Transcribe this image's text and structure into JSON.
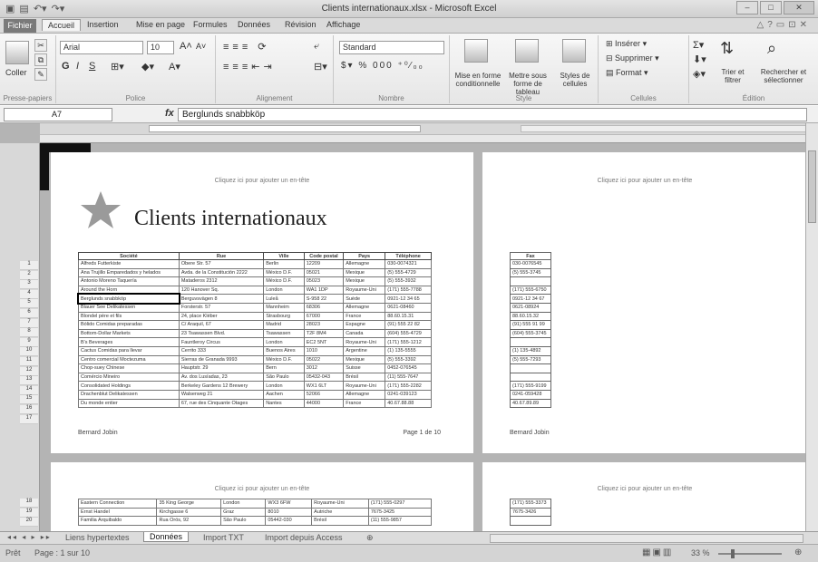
{
  "window": {
    "title": "Clients internationaux.xlsx - Microsoft Excel"
  },
  "qat": {
    "icons": [
      "excel-logo-icon",
      "save-icon",
      "undo-icon",
      "redo-icon"
    ]
  },
  "tabs": [
    "Fichier",
    "Accueil",
    "Insertion",
    "Mise en page",
    "Formules",
    "Données",
    "Révision",
    "Affichage"
  ],
  "ribbon": {
    "clipboard": {
      "paste": "Coller",
      "label": "Presse-papiers"
    },
    "font": {
      "name": "Arial",
      "size": "10",
      "bold": "G",
      "italic": "I",
      "underline": "S",
      "label": "Police"
    },
    "alignment": {
      "label": "Alignement"
    },
    "number": {
      "format": "Standard",
      "label": "Nombre"
    },
    "styles": {
      "conditional": "Mise en forme conditionnelle",
      "as_table": "Mettre sous forme de tableau",
      "cell_styles": "Styles de cellules",
      "label": "Style"
    },
    "cells": {
      "insert": "Insérer",
      "delete": "Supprimer",
      "format": "Format",
      "label": "Cellules"
    },
    "editing": {
      "sort": "Trier et filtrer",
      "find": "Rechercher et sélectionner",
      "label": "Édition"
    }
  },
  "formula_bar": {
    "cell": "A7",
    "fx": "fx",
    "value": "Berglunds snabbköp"
  },
  "page1": {
    "header": "Cliquez ici pour ajouter un en-tête",
    "title": "Clients internationaux",
    "columns": [
      "Société",
      "Rue",
      "Ville",
      "Code postal",
      "Pays",
      "Téléphone"
    ],
    "rows": [
      [
        "Alfreds Futterkiste",
        "Obere Str. 57",
        "Berlin",
        "12209",
        "Allemagne",
        "030-0074321"
      ],
      [
        "Ana Trujillo Emparedados y helados",
        "Avda. de la Constitución 2222",
        "México D.F.",
        "05021",
        "Mexique",
        "(5) 555-4729"
      ],
      [
        "Antonio Moreno Taquería",
        "Mataderos 2312",
        "México D.F.",
        "05023",
        "Mexique",
        "(5) 555-3932"
      ],
      [
        "Around the Horn",
        "120 Hanover Sq.",
        "London",
        "WA1 1DP",
        "Royaume-Uni",
        "(171) 555-7788"
      ],
      [
        "Berglunds snabbköp",
        "Berguvsvägen 8",
        "Luleå",
        "S-958 22",
        "Suède",
        "0921-12 34 65"
      ],
      [
        "Blauer See Delikatessen",
        "Forsterstr. 57",
        "Mannheim",
        "68306",
        "Allemagne",
        "0621-08460"
      ],
      [
        "Blondel père et fils",
        "24, place Kléber",
        "Strasbourg",
        "67000",
        "France",
        "88.60.15.31"
      ],
      [
        "Bólido Comidas preparadas",
        "C/ Araquil, 67",
        "Madrid",
        "28023",
        "Espagne",
        "(91) 555 22 82"
      ],
      [
        "Bottom-Dollar Markets",
        "23 Tsawassen Blvd.",
        "Tsawassen",
        "T2F 8M4",
        "Canada",
        "(604) 555-4729"
      ],
      [
        "B's Beverages",
        "Fauntleroy Circus",
        "London",
        "EC2 5NT",
        "Royaume-Uni",
        "(171) 555-1212"
      ],
      [
        "Cactus Comidas para llevar",
        "Cerrito 333",
        "Buenos Aires",
        "1010",
        "Argentine",
        "(1) 135-5555"
      ],
      [
        "Centro comercial Moctezuma",
        "Sierras de Granada 9993",
        "México D.F.",
        "05022",
        "Mexique",
        "(5) 555-3392"
      ],
      [
        "Chop-suey Chinese",
        "Hauptstr. 29",
        "Bern",
        "3012",
        "Suisse",
        "0452-076545"
      ],
      [
        "Comércio Mineiro",
        "Av. dos Lusíadas, 23",
        "São Paulo",
        "05432-043",
        "Brésil",
        "(11) 555-7647"
      ],
      [
        "Consolidated Holdings",
        "Berkeley Gardens 12 Brewery",
        "London",
        "WX1 6LT",
        "Royaume-Uni",
        "(171) 555-2282"
      ],
      [
        "Drachenblut Delikatessen",
        "Walserweg 21",
        "Aachen",
        "52066",
        "Allemagne",
        "0241-039123"
      ],
      [
        "Du monde entier",
        "67, rue des Cinquante Otages",
        "Nantes",
        "44000",
        "France",
        "40.67.88.88"
      ]
    ],
    "footer_left": "Bernard Jobin",
    "footer_right": "Page 1 de 10"
  },
  "page2": {
    "header": "Cliquez ici pour ajouter un en-tête",
    "fax_header": "Fax",
    "fax": [
      "030-0076545",
      "(5) 555-3745",
      "",
      "(171) 555-6750",
      "0921-12 34 67",
      "0621-08924",
      "88.60.15.32",
      "(91) 555 91 99",
      "(604) 555-3745",
      "",
      "(1) 135-4892",
      "(5) 555-7293",
      "",
      "",
      "(171) 555-9199",
      "0241-059428",
      "40.67.89.89"
    ],
    "footer_left": "Bernard Jobin"
  },
  "page3": {
    "header": "Cliquez ici pour ajouter un en-tête",
    "rows": [
      [
        "Eastern Connection",
        "35 King George",
        "London",
        "WX3 6FW",
        "Royaume-Uni",
        "(171) 555-0297"
      ],
      [
        "Ernst Handel",
        "Kirchgasse 6",
        "Graz",
        "8010",
        "Autriche",
        "7675-3425"
      ],
      [
        "Familia Arquibaldo",
        "Rua Orós, 92",
        "São Paulo",
        "05442-030",
        "Brésil",
        "(11) 555-9857"
      ]
    ],
    "row_numbers": [
      "18",
      "19",
      "20"
    ]
  },
  "page4": {
    "header": "Cliquez ici pour ajouter un en-tête",
    "fax": [
      "(171) 555-3373",
      "7675-3426",
      ""
    ]
  },
  "row_numbers": [
    "1",
    "2",
    "3",
    "4",
    "5",
    "6",
    "7",
    "8",
    "9",
    "10",
    "11",
    "12",
    "13",
    "14",
    "15",
    "16",
    "17"
  ],
  "sheets": [
    "Liens hypertextes",
    "Données",
    "Import TXT",
    "Import depuis Access"
  ],
  "status": {
    "ready": "Prêt",
    "page": "Page : 1 sur 10",
    "zoom": "33 %"
  }
}
